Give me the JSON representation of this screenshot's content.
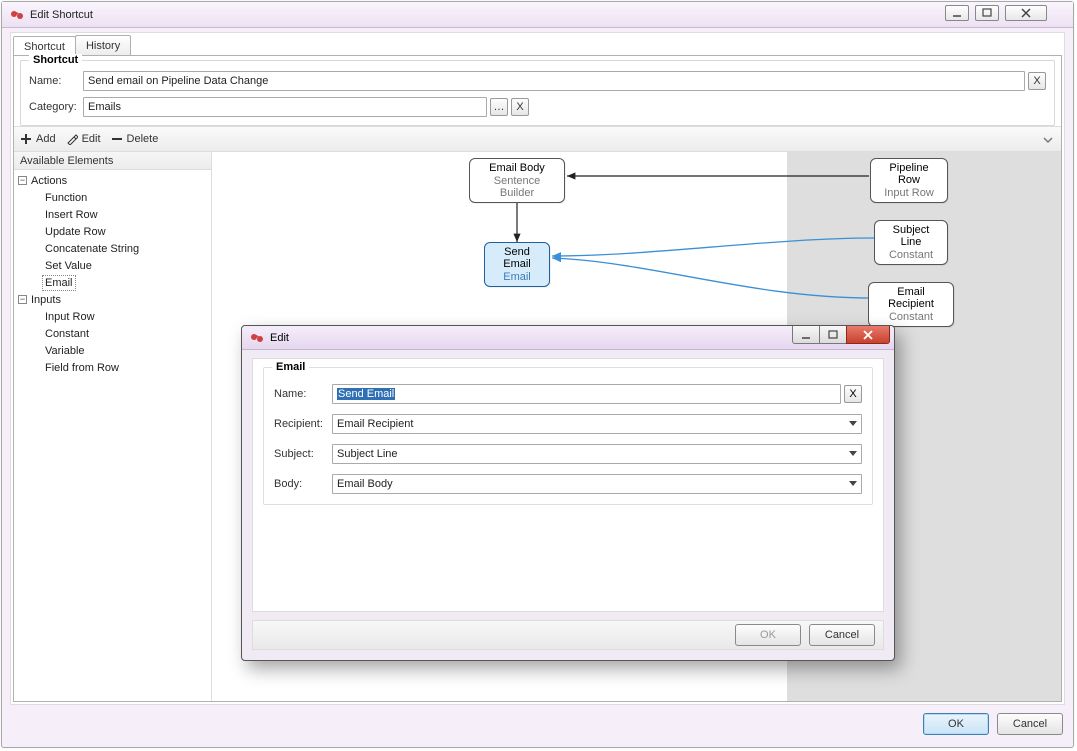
{
  "outer_window": {
    "title": "Edit Shortcut",
    "tabs": {
      "shortcut": "Shortcut",
      "history": "History"
    },
    "fieldset_legend": "Shortcut",
    "name_label": "Name:",
    "name_value": "Send email on Pipeline Data Change",
    "category_label": "Category:",
    "category_value": "Emails",
    "browse_btn": "…",
    "clear_btn": "X",
    "name_clear_btn": "X"
  },
  "toolbar": {
    "add": "Add",
    "edit": "Edit",
    "delete": "Delete"
  },
  "tree": {
    "header": "Available Elements",
    "actions_label": "Actions",
    "actions": [
      "Function",
      "Insert Row",
      "Update Row",
      "Concatenate String",
      "Set Value",
      "Email"
    ],
    "selected_action_index": 5,
    "inputs_label": "Inputs",
    "inputs": [
      "Input Row",
      "Constant",
      "Variable",
      "Field from Row"
    ]
  },
  "canvas": {
    "nodes": {
      "email_body": {
        "title": "Email Body",
        "sub": "Sentence Builder"
      },
      "send_email": {
        "title": "Send Email",
        "sub": "Email"
      },
      "pipeline_row": {
        "title": "Pipeline Row",
        "sub": "Input Row"
      },
      "subject_line": {
        "title": "Subject Line",
        "sub": "Constant"
      },
      "email_recipient": {
        "title": "Email Recipient",
        "sub": "Constant"
      }
    }
  },
  "dialog": {
    "title": "Edit",
    "group_legend": "Email",
    "name_label": "Name:",
    "name_value": "Send Email",
    "name_clear_btn": "X",
    "recipient_label": "Recipient:",
    "recipient_value": "Email Recipient",
    "subject_label": "Subject:",
    "subject_value": "Subject Line",
    "body_label": "Body:",
    "body_value": "Email Body",
    "ok": "OK",
    "cancel": "Cancel"
  },
  "footer": {
    "ok": "OK",
    "cancel": "Cancel"
  }
}
